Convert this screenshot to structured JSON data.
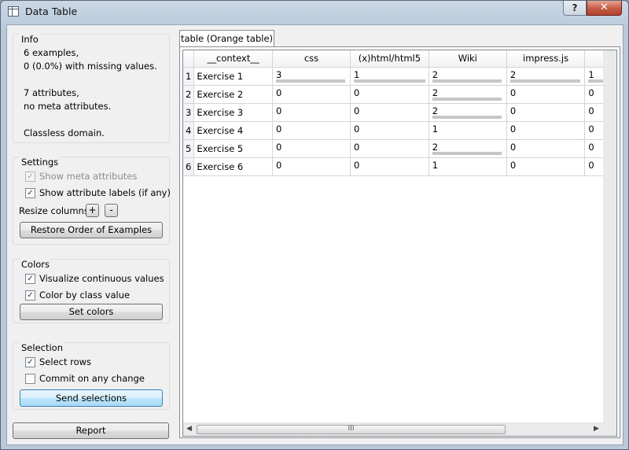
{
  "window": {
    "title": "Data Table",
    "help_label": "?",
    "close_label": "✕"
  },
  "info": {
    "title": "Info",
    "lines": [
      "6 examples,",
      "0 (0.0%) with missing values.",
      "7 attributes,",
      "no meta attributes.",
      "Classless domain."
    ]
  },
  "settings": {
    "title": "Settings",
    "show_meta": {
      "label": "Show meta attributes",
      "checked": true,
      "enabled": false
    },
    "show_labels": {
      "label": "Show attribute labels (if any)",
      "checked": true
    },
    "resize_label": "Resize columns:",
    "plus_label": "+",
    "minus_label": "-",
    "restore_label": "Restore Order of Examples"
  },
  "colors": {
    "title": "Colors",
    "visualize": {
      "label": "Visualize continuous values",
      "checked": true
    },
    "color_by_class": {
      "label": "Color by class value",
      "checked": true
    },
    "set_colors_label": "Set colors"
  },
  "selection": {
    "title": "Selection",
    "select_rows": {
      "label": "Select rows",
      "checked": true
    },
    "commit": {
      "label": "Commit on any change",
      "checked": false
    },
    "send_label": "Send selections"
  },
  "report_label": "Report",
  "tab_label": "table (Orange table)",
  "table": {
    "columns": [
      "__context__",
      "css",
      "(x)html/html5",
      "Wiki",
      "impress.js"
    ],
    "rows": [
      {
        "num": "1",
        "name": "Exercise 1",
        "values": [
          "3",
          "1",
          "2",
          "2",
          "1"
        ],
        "bars": [
          0.98,
          1.0,
          0.98,
          0.98,
          1.0
        ]
      },
      {
        "num": "2",
        "name": "Exercise 2",
        "values": [
          "0",
          "0",
          "2",
          "0",
          "0"
        ],
        "bars": [
          0,
          0,
          0.98,
          0,
          0
        ]
      },
      {
        "num": "3",
        "name": "Exercise 3",
        "values": [
          "0",
          "0",
          "2",
          "0",
          "0"
        ],
        "bars": [
          0,
          0,
          0.98,
          0,
          0
        ]
      },
      {
        "num": "4",
        "name": "Exercise 4",
        "values": [
          "0",
          "0",
          "1",
          "0",
          "0"
        ],
        "bars": [
          0,
          0,
          0,
          0,
          0
        ]
      },
      {
        "num": "5",
        "name": "Exercise 5",
        "values": [
          "0",
          "0",
          "2",
          "0",
          "0"
        ],
        "bars": [
          0,
          0,
          0.98,
          0,
          0
        ]
      },
      {
        "num": "6",
        "name": "Exercise 6",
        "values": [
          "0",
          "0",
          "1",
          "0",
          "0"
        ],
        "bars": [
          0,
          0,
          0,
          0,
          0
        ]
      }
    ]
  },
  "scrollbar": {
    "grip": "III",
    "left_arrow": "◀",
    "right_arrow": "▶"
  }
}
